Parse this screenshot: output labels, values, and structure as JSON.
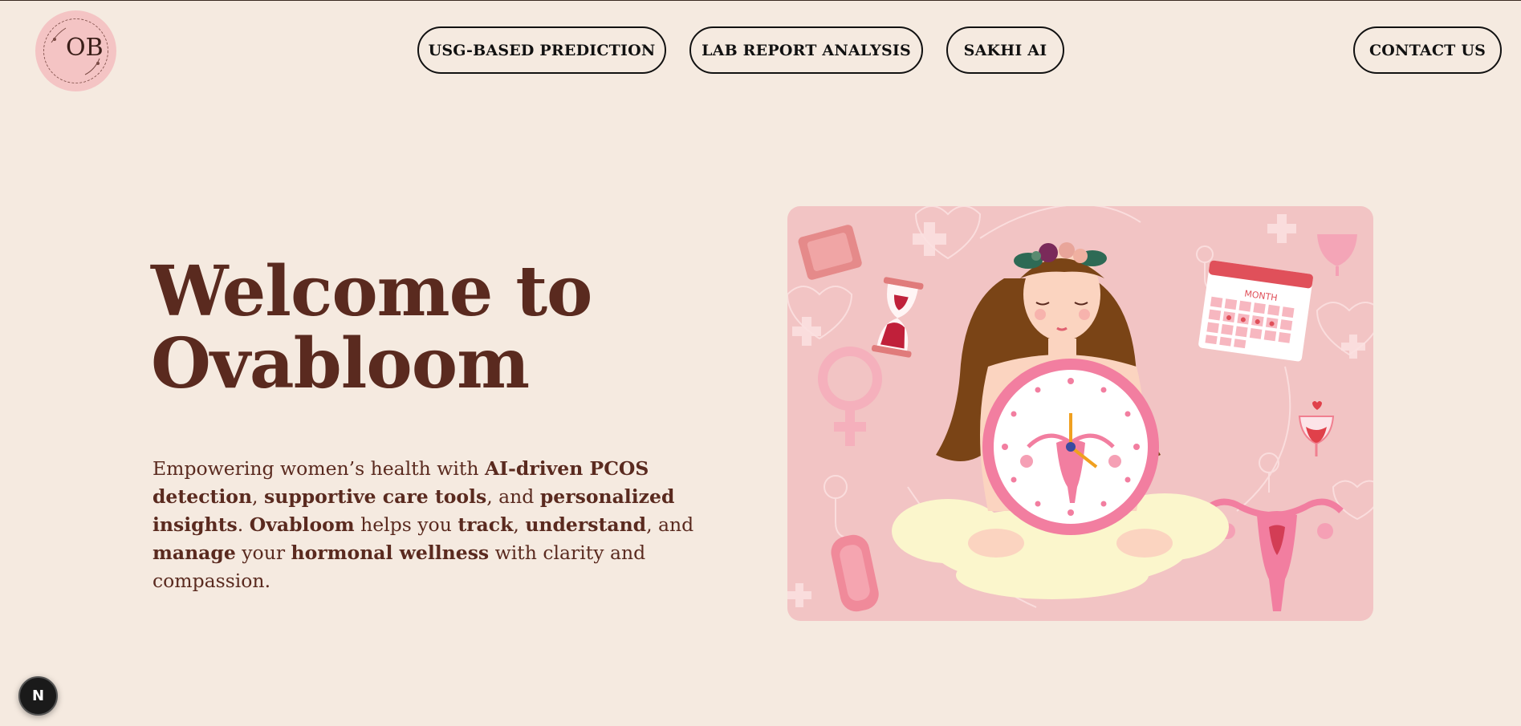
{
  "header": {
    "logo_text": "OB",
    "nav": [
      {
        "label": "USG-BASED PREDICTION"
      },
      {
        "label": "LAB REPORT ANALYSIS"
      },
      {
        "label": "SAKHI AI"
      }
    ],
    "contact_label": "CONTACT US"
  },
  "hero": {
    "title_line1": "Welcome to",
    "title_line2": "Ovabloom",
    "desc": {
      "p1": "Empowering women’s health with ",
      "b1": "AI-driven PCOS detection",
      "p2": ", ",
      "b2": "supportive care tools",
      "p3": ", and ",
      "b3": "personalized insights",
      "p4": ". ",
      "b4": "Ovabloom",
      "p5": " helps you ",
      "b5": "track",
      "p6": ", ",
      "b6": "understand",
      "p7": ", and ",
      "b7": "manage",
      "p8": " your ",
      "b8": "hormonal wellness",
      "p9": " with clarity and compassion."
    },
    "illustration": {
      "calendar_label": "MONTH"
    }
  },
  "dev_badge": {
    "label": "N"
  },
  "colors": {
    "background": "#f5eae0",
    "text": "#5a2a1f",
    "illustration_bg": "#f2c4c4",
    "accent_pink": "#f27ea0"
  }
}
